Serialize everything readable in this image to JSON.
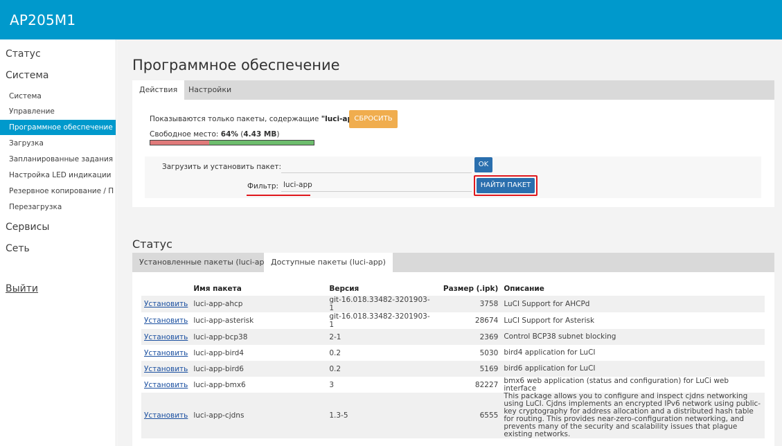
{
  "app": {
    "brand": "AP205M1"
  },
  "sidebar": {
    "categories": [
      {
        "label": "Статус"
      },
      {
        "label": "Система"
      },
      {
        "label": "Сервисы"
      },
      {
        "label": "Сеть"
      }
    ],
    "system_items": [
      {
        "label": "Система",
        "active": false
      },
      {
        "label": "Управление",
        "active": false
      },
      {
        "label": "Программное обеспечение",
        "active": true
      },
      {
        "label": "Загрузка",
        "active": false
      },
      {
        "label": "Запланированные задания",
        "active": false
      },
      {
        "label": "Настройка LED индикации",
        "active": false
      },
      {
        "label": "Резервное копирование / П",
        "active": false
      },
      {
        "label": "Перезагрузка",
        "active": false
      }
    ],
    "logout": "Выйти"
  },
  "software": {
    "title": "Программное обеспечение",
    "tabs": [
      {
        "label": "Действия",
        "active": true
      },
      {
        "label": "Настройки",
        "active": false
      }
    ],
    "filter_prefix": "Показываются только пакеты, содержащие ",
    "filter_value": "\"luci-app\"",
    "reset_label": "СБРОСИТЬ",
    "space_prefix": "Свободное место: ",
    "space_percent": "64%",
    "space_open": " (",
    "space_mb": "4.43 MB",
    "space_close": ")",
    "space_free_fraction": 0.64,
    "upload_label": "Загрузить и установить пакет:",
    "ok_label": "OK",
    "filter_label": "Фильтр:",
    "filter_input": "luci-app",
    "find_label": "НАЙТИ ПАКЕТ"
  },
  "status": {
    "title": "Статус",
    "tabs": [
      {
        "label": "Установленные пакеты (luci-app)",
        "active": false
      },
      {
        "label": "Доступные пакеты (luci-app)",
        "active": true
      }
    ],
    "columns": {
      "name": "Имя пакета",
      "version": "Версия",
      "size": "Размер (.ipk)",
      "desc": "Описание"
    },
    "install_label": "Установить",
    "rows": [
      {
        "name": "luci-app-ahcp",
        "version": "git-16.018.33482-3201903-1",
        "size": "3758",
        "desc": "LuCI Support for AHCPd"
      },
      {
        "name": "luci-app-asterisk",
        "version": "git-16.018.33482-3201903-1",
        "size": "28674",
        "desc": "LuCI Support for Asterisk"
      },
      {
        "name": "luci-app-bcp38",
        "version": "2-1",
        "size": "2369",
        "desc": "Control BCP38 subnet blocking"
      },
      {
        "name": "luci-app-bird4",
        "version": "0.2",
        "size": "5030",
        "desc": "bird4 application for LuCI"
      },
      {
        "name": "luci-app-bird6",
        "version": "0.2",
        "size": "5169",
        "desc": "bird6 application for LuCI"
      },
      {
        "name": "luci-app-bmx6",
        "version": "3",
        "size": "82227",
        "desc": "bmx6 web application (status and configuration) for LuCi web interface"
      },
      {
        "name": "luci-app-cjdns",
        "version": "1.3-5",
        "size": "6555",
        "desc": "This package allows you to configure and inspect cjdns networking using LuCI. Cjdns implements an encrypted IPv6 network using public-key cryptography for address allocation and a distributed hash table for routing. This provides near-zero-configuration networking, and prevents many of the security and scalability issues that plague existing networks."
      }
    ]
  }
}
